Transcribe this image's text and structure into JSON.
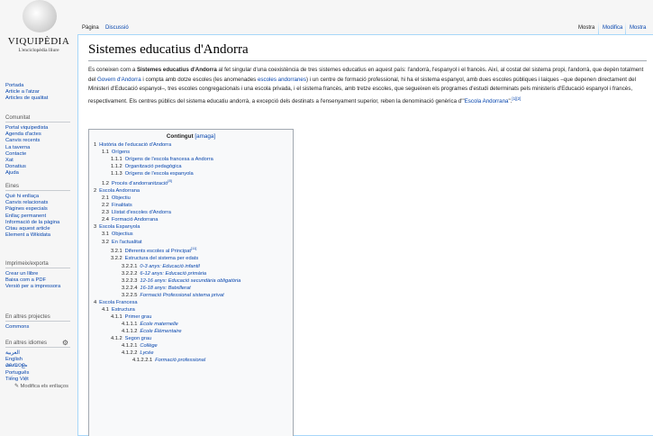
{
  "logo": {
    "wordmark": "VIQUIPÈDIA",
    "tagline": "L'enciclopèdia lliure"
  },
  "nav": {
    "main": [
      "Portada",
      "Article a l'atzar",
      "Articles de qualitat"
    ],
    "community": {
      "title": "Comunitat",
      "items": [
        "Portal viquipedista",
        "Agenda d'actes",
        "Canvis recents",
        "La taverna",
        "Contacte",
        "Xat",
        "Donatius",
        "Ajuda"
      ]
    },
    "tools": {
      "title": "Eines",
      "items": [
        "Què hi enllaça",
        "Canvis relacionats",
        "Pàgines especials",
        "Enllaç permanent",
        "Informació de la pàgina",
        "Citau aquest article",
        "Element a Wikidata"
      ]
    },
    "print": {
      "title": "Imprimeix/exporta",
      "items": [
        "Crear un llibre",
        "Baixa com a PDF",
        "Versió per a impressora"
      ]
    },
    "projects": {
      "title": "En altres projectes",
      "items": [
        "Commons"
      ]
    },
    "languages": {
      "title": "En altres idiomes",
      "items": [
        "العربية",
        "English",
        "മലയാളം",
        "Português",
        "Tiếng Việt"
      ],
      "edit_links": "✎ Modifica els enllaços"
    }
  },
  "tabs": {
    "page": "Pàgina",
    "discussion": "Discussió",
    "read": "Mostra",
    "edit": "Modifica",
    "history": "Mostra"
  },
  "article": {
    "title": "Sistemes educatius d'Andorra",
    "intro_start": "Es coneixen com a ",
    "intro_bold": "Sistemes educatius d'Andorra",
    "intro_p1": " al fet singular d'una coexistència de tres sistemes educatius en aquest país: l'andorrà, l'espanyol i el francès. Així, al costat del sistema propi, l'andorrà, que depèn totalment del ",
    "intro_link1": "Govern d'Andorra",
    "intro_p2": " i compta amb dotze escoles (les anomenades ",
    "intro_link2": "escoles andorranes",
    "intro_p3": ") i un centre de formació professional, hi ha el sistema espanyol, amb dues escoles públiques i laiques –que depenen directament del Ministeri d'Educació espanyol–, tres escoles congregacionals i una escola privada, i el sistema francès, amb tretze escoles, que segueixen els programes d'estudi determinats pels ministeris d'Educació espanyol i francès, respectivament. Els centres públics del sistema educatiu andorrà, a excepció dels destinats a l'ensenyament superior, reben la denominació genèrica d'\"",
    "intro_link3": "Escola Andorrana",
    "intro_p4": "\".",
    "intro_refs": "[1][2]"
  },
  "toc": {
    "title": "Contingut",
    "toggle": "[amaga]",
    "items": [
      {
        "level": 1,
        "num": "1",
        "text": "Història de l'educació d'Andorra"
      },
      {
        "level": 2,
        "num": "1.1",
        "text": "Orígens"
      },
      {
        "level": 3,
        "num": "1.1.1",
        "text": "Orígens de l'escola francesa a Andorra"
      },
      {
        "level": 3,
        "num": "1.1.2",
        "text": "Organització pedagògica"
      },
      {
        "level": 3,
        "num": "1.1.3",
        "text": "Orígens de l'escola espanyola"
      },
      {
        "level": 2,
        "num": "1.2",
        "text": "Procés d'andorranització",
        "sup": "[8]"
      },
      {
        "level": 1,
        "num": "2",
        "text": "Escola Andorrana"
      },
      {
        "level": 2,
        "num": "2.1",
        "text": "Objectiu"
      },
      {
        "level": 2,
        "num": "2.2",
        "text": "Finalitats"
      },
      {
        "level": 2,
        "num": "2.3",
        "text": "Llistat d'escoles d'Andorra"
      },
      {
        "level": 2,
        "num": "2.4",
        "text": "Formació Andorrana"
      },
      {
        "level": 1,
        "num": "3",
        "text": "Escola Espanyola"
      },
      {
        "level": 2,
        "num": "3.1",
        "text": "Objectius"
      },
      {
        "level": 2,
        "num": "3.2",
        "text": "En l'actualitat"
      },
      {
        "level": 3,
        "num": "3.2.1",
        "text": "Diferents escoles al Principat",
        "sup": "[11]"
      },
      {
        "level": 3,
        "num": "3.2.2",
        "text": "Estructura del sistema per edats"
      },
      {
        "level": 4,
        "num": "3.2.2.1",
        "text": "0-3 anys: Educació infantil",
        "italic": true
      },
      {
        "level": 4,
        "num": "3.2.2.2",
        "text": "6-12 anys: Educació primària",
        "italic": true
      },
      {
        "level": 4,
        "num": "3.2.2.3",
        "text": "12-16 anys: Educació secundària obligatòria",
        "italic": true
      },
      {
        "level": 4,
        "num": "3.2.2.4",
        "text": "16-18 anys: Batxillerat",
        "italic": true
      },
      {
        "level": 4,
        "num": "3.2.2.5",
        "text": "Formació Professional sistema privat",
        "italic": true
      },
      {
        "level": 1,
        "num": "4",
        "text": "Escola Francesa"
      },
      {
        "level": 2,
        "num": "4.1",
        "text": "Estructura"
      },
      {
        "level": 3,
        "num": "4.1.1",
        "text": "Primer grau"
      },
      {
        "level": 4,
        "num": "4.1.1.1",
        "text": "École maternelle",
        "italic": true
      },
      {
        "level": 4,
        "num": "4.1.1.2",
        "text": "École Élémentaire",
        "italic": true
      },
      {
        "level": 3,
        "num": "4.1.2",
        "text": "Segon grau"
      },
      {
        "level": 4,
        "num": "4.1.2.1",
        "text": "Collège",
        "italic": true
      },
      {
        "level": 4,
        "num": "4.1.2.2",
        "text": "Lycée",
        "italic": true
      },
      {
        "level": 5,
        "num": "4.1.2.2.1",
        "text": "Formació professional",
        "italic": true
      }
    ]
  }
}
